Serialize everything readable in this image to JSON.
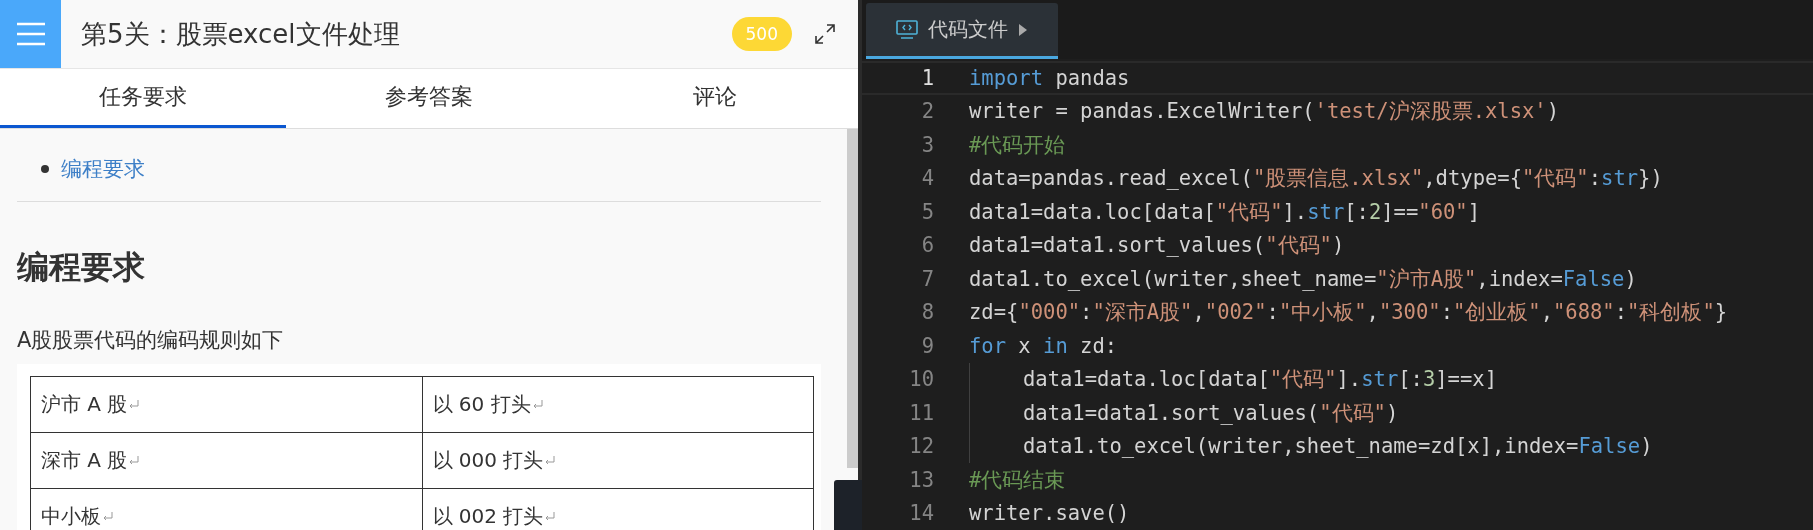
{
  "task_panel": {
    "title": "第5关：股票excel文件处理",
    "score_badge": "500",
    "tabs": [
      {
        "label": "任务要求",
        "selected": true
      },
      {
        "label": "参考答案",
        "selected": false
      },
      {
        "label": "评论",
        "selected": false
      }
    ],
    "toc": [
      {
        "label": "编程要求"
      }
    ],
    "heading": "编程要求",
    "intro": "A股股票代码的编码规则如下",
    "table_rows": [
      [
        "沪市 A 股",
        "以 60 打头"
      ],
      [
        "深市 A 股",
        "以 000 打头"
      ],
      [
        "中小板",
        "以 002 打头"
      ]
    ]
  },
  "editor": {
    "tabs": [
      {
        "label": "代码文件",
        "selected": true
      }
    ],
    "lines": [
      {
        "number": "1",
        "indent": false,
        "current": true,
        "tokens": [
          {
            "t": "import",
            "kind": "keyword"
          },
          {
            "t": " pandas",
            "kind": "plain"
          }
        ]
      },
      {
        "number": "2",
        "indent": false,
        "current": false,
        "tokens": [
          {
            "t": "writer = pandas.ExcelWriter(",
            "kind": "plain"
          },
          {
            "t": "'test/沪深股票.xlsx'",
            "kind": "string"
          },
          {
            "t": ")",
            "kind": "plain"
          }
        ]
      },
      {
        "number": "3",
        "indent": false,
        "current": false,
        "tokens": [
          {
            "t": "#代码开始",
            "kind": "comment"
          }
        ]
      },
      {
        "number": "4",
        "indent": false,
        "current": false,
        "tokens": [
          {
            "t": "data=pandas.read_excel(",
            "kind": "plain"
          },
          {
            "t": "\"股票信息.xlsx\"",
            "kind": "string"
          },
          {
            "t": ",dtype={",
            "kind": "plain"
          },
          {
            "t": "\"代码\"",
            "kind": "string"
          },
          {
            "t": ":",
            "kind": "plain"
          },
          {
            "t": "str",
            "kind": "keyword"
          },
          {
            "t": "})",
            "kind": "plain"
          }
        ]
      },
      {
        "number": "5",
        "indent": false,
        "current": false,
        "tokens": [
          {
            "t": "data1=data.loc[data[",
            "kind": "plain"
          },
          {
            "t": "\"代码\"",
            "kind": "string"
          },
          {
            "t": "].",
            "kind": "plain"
          },
          {
            "t": "str",
            "kind": "keyword"
          },
          {
            "t": "[:",
            "kind": "plain"
          },
          {
            "t": "2",
            "kind": "number"
          },
          {
            "t": "]==",
            "kind": "plain"
          },
          {
            "t": "\"60\"",
            "kind": "string"
          },
          {
            "t": "]",
            "kind": "plain"
          }
        ]
      },
      {
        "number": "6",
        "indent": false,
        "current": false,
        "tokens": [
          {
            "t": "data1=data1.sort_values(",
            "kind": "plain"
          },
          {
            "t": "\"代码\"",
            "kind": "string"
          },
          {
            "t": ")",
            "kind": "plain"
          }
        ]
      },
      {
        "number": "7",
        "indent": false,
        "current": false,
        "tokens": [
          {
            "t": "data1.to_excel(writer,sheet_name=",
            "kind": "plain"
          },
          {
            "t": "\"沪市A股\"",
            "kind": "string"
          },
          {
            "t": ",index=",
            "kind": "plain"
          },
          {
            "t": "False",
            "kind": "keyword"
          },
          {
            "t": ")",
            "kind": "plain"
          }
        ]
      },
      {
        "number": "8",
        "indent": false,
        "current": false,
        "tokens": [
          {
            "t": "zd={",
            "kind": "plain"
          },
          {
            "t": "\"000\"",
            "kind": "string"
          },
          {
            "t": ":",
            "kind": "plain"
          },
          {
            "t": "\"深市A股\"",
            "kind": "string"
          },
          {
            "t": ",",
            "kind": "plain"
          },
          {
            "t": "\"002\"",
            "kind": "string"
          },
          {
            "t": ":",
            "kind": "plain"
          },
          {
            "t": "\"中小板\"",
            "kind": "string"
          },
          {
            "t": ",",
            "kind": "plain"
          },
          {
            "t": "\"300\"",
            "kind": "string"
          },
          {
            "t": ":",
            "kind": "plain"
          },
          {
            "t": "\"创业板\"",
            "kind": "string"
          },
          {
            "t": ",",
            "kind": "plain"
          },
          {
            "t": "\"688\"",
            "kind": "string"
          },
          {
            "t": ":",
            "kind": "plain"
          },
          {
            "t": "\"科创板\"",
            "kind": "string"
          },
          {
            "t": "}",
            "kind": "plain"
          }
        ]
      },
      {
        "number": "9",
        "indent": false,
        "current": false,
        "tokens": [
          {
            "t": "for",
            "kind": "keyword"
          },
          {
            "t": " x ",
            "kind": "plain"
          },
          {
            "t": "in",
            "kind": "keyword"
          },
          {
            "t": " zd:",
            "kind": "plain"
          }
        ]
      },
      {
        "number": "10",
        "indent": true,
        "current": false,
        "tokens": [
          {
            "t": "data1=data.loc[data[",
            "kind": "plain"
          },
          {
            "t": "\"代码\"",
            "kind": "string"
          },
          {
            "t": "].",
            "kind": "plain"
          },
          {
            "t": "str",
            "kind": "keyword"
          },
          {
            "t": "[:",
            "kind": "plain"
          },
          {
            "t": "3",
            "kind": "number"
          },
          {
            "t": "]==x]",
            "kind": "plain"
          }
        ]
      },
      {
        "number": "11",
        "indent": true,
        "current": false,
        "tokens": [
          {
            "t": "data1=data1.sort_values(",
            "kind": "plain"
          },
          {
            "t": "\"代码\"",
            "kind": "string"
          },
          {
            "t": ")",
            "kind": "plain"
          }
        ]
      },
      {
        "number": "12",
        "indent": true,
        "current": false,
        "tokens": [
          {
            "t": "data1.to_excel(writer,sheet_name=zd[x],index=",
            "kind": "plain"
          },
          {
            "t": "False",
            "kind": "keyword"
          },
          {
            "t": ")",
            "kind": "plain"
          }
        ]
      },
      {
        "number": "13",
        "indent": false,
        "current": false,
        "tokens": [
          {
            "t": "#代码结束",
            "kind": "comment"
          }
        ]
      },
      {
        "number": "14",
        "indent": false,
        "current": false,
        "tokens": [
          {
            "t": "writer.save()",
            "kind": "plain"
          }
        ]
      }
    ]
  }
}
